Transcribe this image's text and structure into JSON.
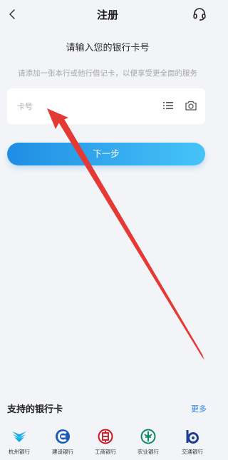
{
  "header": {
    "title": "注册"
  },
  "form": {
    "heading": "请输入您的银行卡号",
    "hint": "请添加一张本行或他行借记卡，以便享受更全面的服务",
    "card_placeholder": "卡号",
    "next_label": "下一步"
  },
  "supported": {
    "title": "支持的银行卡",
    "more_label": "更多",
    "banks": [
      {
        "name": "杭州银行",
        "icon": "hangzhou-bank-logo",
        "color": "#17a8e0"
      },
      {
        "name": "建设银行",
        "icon": "ccb-logo",
        "color": "#1a5bb8"
      },
      {
        "name": "工商银行",
        "icon": "icbc-logo",
        "color": "#c4161c"
      },
      {
        "name": "农业银行",
        "icon": "abc-logo",
        "color": "#0a8a63"
      },
      {
        "name": "交通银行",
        "icon": "bocom-logo",
        "color": "#1c3f93"
      }
    ]
  },
  "colors": {
    "accent_start": "#1f8de3",
    "accent_end": "#47c3f8",
    "link": "#2a84e6",
    "background": "#f3f4f7",
    "annotation": "#e53935"
  }
}
